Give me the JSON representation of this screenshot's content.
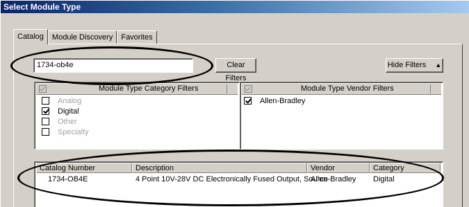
{
  "window": {
    "title": "Select Module Type"
  },
  "tabs": [
    {
      "label": "Catalog",
      "active": true
    },
    {
      "label": "Module Discovery",
      "active": false
    },
    {
      "label": "Favorites",
      "active": false
    }
  ],
  "search": {
    "value": "1734-ob4e"
  },
  "buttons": {
    "clear_filters": "Clear Filters",
    "hide_filters": "Hide Filters",
    "hide_filters_icon": "double-chevron-up-icon"
  },
  "category_filters": {
    "title": "Module Type Category Filters",
    "items": [
      {
        "label": "Analog",
        "checked": false,
        "enabled": false
      },
      {
        "label": "Digital",
        "checked": true,
        "enabled": true
      },
      {
        "label": "Other",
        "checked": false,
        "enabled": false
      },
      {
        "label": "Specialty",
        "checked": false,
        "enabled": false
      }
    ]
  },
  "vendor_filters": {
    "title": "Module Type Vendor Filters",
    "items": [
      {
        "label": "Allen-Bradley",
        "checked": true
      }
    ]
  },
  "results": {
    "columns": [
      "Catalog Number",
      "Description",
      "Vendor",
      "Category"
    ],
    "rows": [
      [
        "1734-OB4E",
        "4 Point 10V-28V DC Electronically Fused Output, Source",
        "Allen-Bradley",
        "Digital"
      ]
    ]
  },
  "colors": {
    "title_start": "#0a246a",
    "title_end": "#a6caf0",
    "face": "#d4d0c8",
    "annotation": "#000000"
  }
}
